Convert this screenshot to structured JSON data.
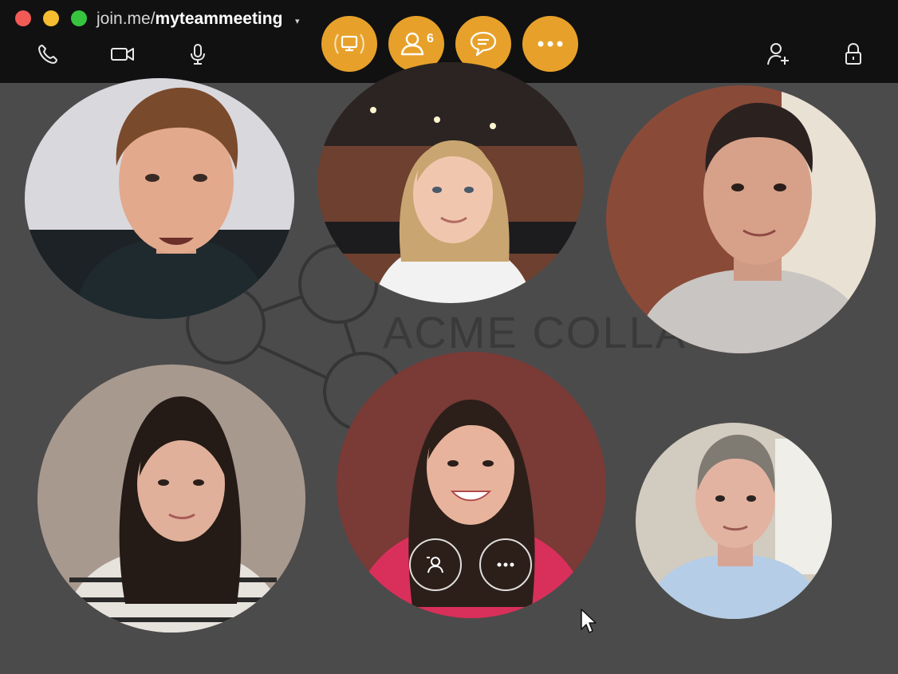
{
  "window": {
    "title_prefix": "join.me/",
    "title_room": "myteammeeting",
    "title_caret": "▾"
  },
  "toolbar": {
    "left_icons": [
      "phone-icon",
      "video-camera-icon",
      "microphone-icon"
    ],
    "center_buttons": [
      {
        "name": "screen-share-icon"
      },
      {
        "name": "participants-icon",
        "badge": "6"
      },
      {
        "name": "chat-icon"
      },
      {
        "name": "more-icon"
      }
    ],
    "right_icons": [
      "add-participant-icon",
      "lock-icon"
    ],
    "accent_color": "#e7a12a"
  },
  "background": {
    "logo_text": "ACME COLLA"
  },
  "participants": [
    {
      "name": "participant-1",
      "shirt": "#1f2a2e",
      "skin": "#e3a98d",
      "hair": "#7a4a2d",
      "bg": "#d9d8dd"
    },
    {
      "name": "participant-2",
      "shirt": "#f2f2f2",
      "skin": "#f0c7ae",
      "hair": "#c9a671",
      "bg": "#6d4030"
    },
    {
      "name": "participant-3",
      "shirt": "#c9c5c2",
      "skin": "#d7a189",
      "hair": "#2b2220",
      "bg": "#8a4a38"
    },
    {
      "name": "participant-4",
      "shirt": "#e6e2dc",
      "skin": "#e0b09a",
      "hair": "#241a16",
      "bg": "#a8998f"
    },
    {
      "name": "participant-5",
      "shirt": "#d8305a",
      "skin": "#e8b39c",
      "hair": "#2c1f19",
      "bg": "#7a3a36"
    },
    {
      "name": "participant-6",
      "shirt": "#b5cde6",
      "skin": "#e3b3a2",
      "hair": "#7f7a72",
      "bg": "#d2cbbf"
    }
  ],
  "tile_controls": [
    "pin-participant-icon",
    "more-options-icon"
  ]
}
